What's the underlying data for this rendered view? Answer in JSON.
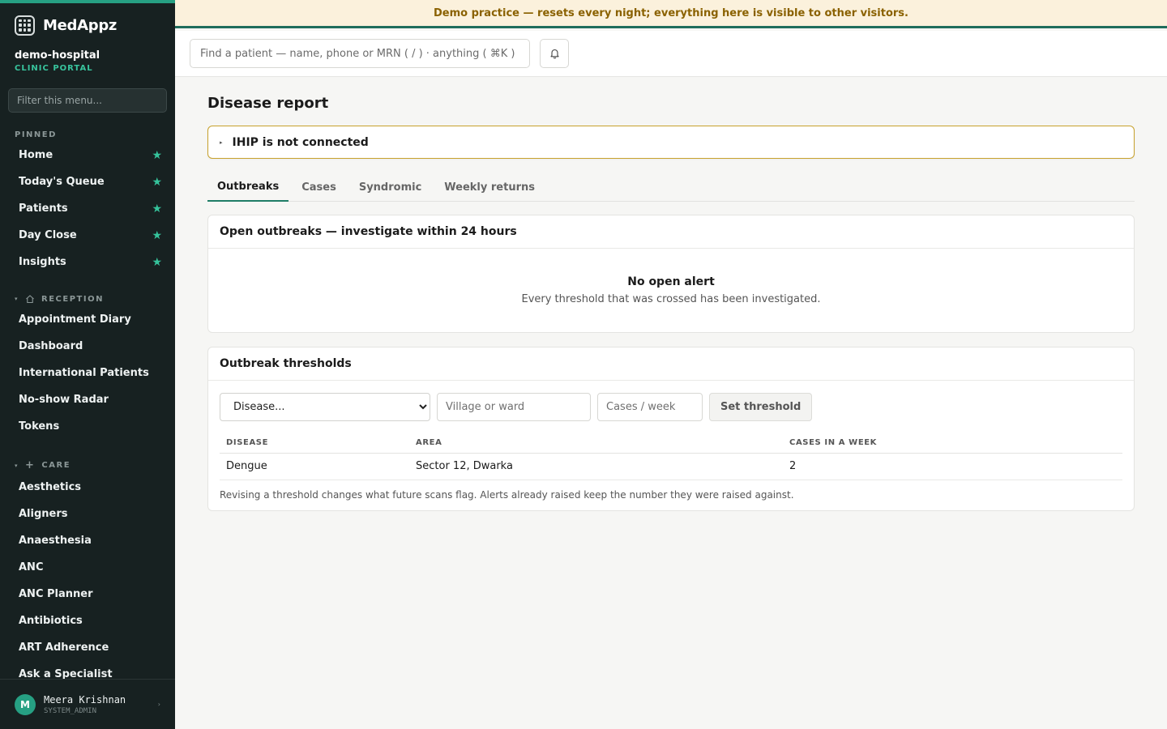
{
  "brand": {
    "name": "MedAppz"
  },
  "org": {
    "name": "demo-hospital",
    "subtitle": "CLINIC PORTAL"
  },
  "sidebar": {
    "filter_placeholder": "Filter this menu...",
    "pinned_label": "PINNED",
    "pinned": [
      {
        "label": "Home",
        "pinned": true
      },
      {
        "label": "Today's Queue",
        "pinned": true
      },
      {
        "label": "Patients",
        "pinned": true
      },
      {
        "label": "Day Close",
        "pinned": true
      },
      {
        "label": "Insights",
        "pinned": true
      }
    ],
    "reception_label": "RECEPTION",
    "reception": [
      {
        "label": "Appointment Diary"
      },
      {
        "label": "Dashboard"
      },
      {
        "label": "International Patients"
      },
      {
        "label": "No-show Radar"
      },
      {
        "label": "Tokens"
      }
    ],
    "care_label": "CARE",
    "care": [
      {
        "label": "Aesthetics"
      },
      {
        "label": "Aligners"
      },
      {
        "label": "Anaesthesia"
      },
      {
        "label": "ANC"
      },
      {
        "label": "ANC Planner"
      },
      {
        "label": "Antibiotics"
      },
      {
        "label": "ART Adherence"
      },
      {
        "label": "Ask a Specialist"
      }
    ],
    "star_glyph": "★"
  },
  "user": {
    "initial": "M",
    "name": "Meera Krishnan",
    "role": "SYSTEM_ADMIN"
  },
  "banner": {
    "text": "Demo practice — resets every night; everything here is visible to other visitors."
  },
  "topbar": {
    "search_placeholder": "Find a patient — name, phone or MRN ( / ) · anything ( ⌘K )"
  },
  "page": {
    "title": "Disease report",
    "ihip_text": "IHIP is not connected",
    "tabs": [
      {
        "label": "Outbreaks",
        "active": true
      },
      {
        "label": "Cases",
        "active": false
      },
      {
        "label": "Syndromic",
        "active": false
      },
      {
        "label": "Weekly returns",
        "active": false
      }
    ],
    "outbreaks_card": {
      "title": "Open outbreaks — investigate within 24 hours",
      "empty_title": "No open alert",
      "empty_sub": "Every threshold that was crossed has been investigated."
    },
    "thresholds_card": {
      "title": "Outbreak thresholds",
      "disease_select": "Disease...",
      "village_placeholder": "Village or ward",
      "cases_placeholder": "Cases / week",
      "set_button": "Set threshold",
      "columns": [
        "DISEASE",
        "AREA",
        "CASES IN A WEEK"
      ],
      "rows": [
        {
          "disease": "Dengue",
          "area": "Sector 12, Dwarka",
          "cases": "2"
        }
      ],
      "note": "Revising a threshold changes what future scans flag. Alerts already raised keep the number they were raised against."
    }
  },
  "colors": {
    "sidebar_bg": "#172121",
    "accent": "#26a083",
    "banner_bg": "#fbf1dc",
    "banner_text": "#8a6100",
    "ihip_border": "#c7a12c"
  }
}
